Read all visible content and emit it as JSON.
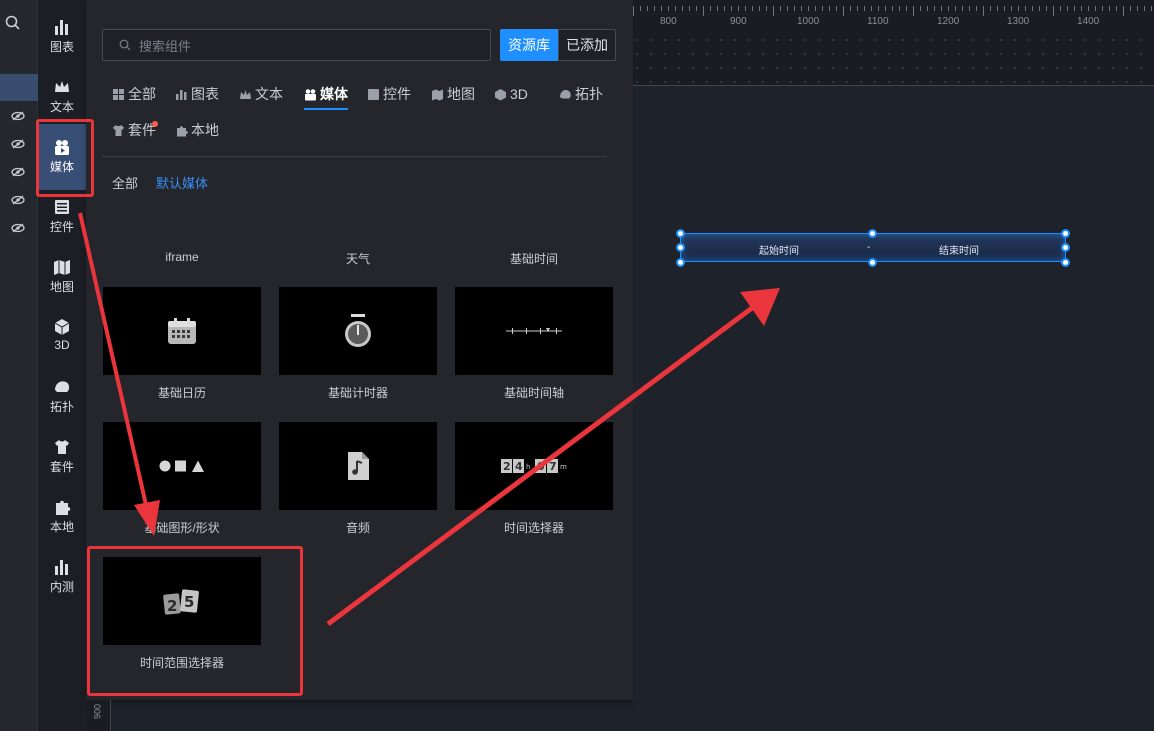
{
  "sidebar": {
    "categories": [
      {
        "label": "图表",
        "icon": "bar-chart-icon"
      },
      {
        "label": "文本",
        "icon": "crown-icon"
      },
      {
        "label": "媒体",
        "icon": "media-icon"
      },
      {
        "label": "控件",
        "icon": "widget-icon"
      },
      {
        "label": "地图",
        "icon": "map-icon"
      },
      {
        "label": "3D",
        "icon": "cube-icon"
      },
      {
        "label": "拓扑",
        "icon": "topology-icon"
      },
      {
        "label": "套件",
        "icon": "shirt-icon"
      },
      {
        "label": "本地",
        "icon": "puzzle-icon"
      },
      {
        "label": "内测",
        "icon": "bar-chart-icon"
      }
    ],
    "active_index": 2
  },
  "panel": {
    "search_placeholder": "搜索组件",
    "btn_library": "资源库",
    "btn_added": "已添加",
    "tabs": [
      "全部",
      "图表",
      "文本",
      "媒体",
      "控件",
      "地图",
      "3D",
      "拓扑",
      "套件",
      "本地"
    ],
    "active_tab": "媒体",
    "subtabs": [
      "全部",
      "默认媒体"
    ],
    "active_subtab": "默认媒体",
    "top_labels": [
      "iframe",
      "天气",
      "基础时间"
    ],
    "components": [
      {
        "label": "基础日历",
        "icon": "calendar-icon"
      },
      {
        "label": "基础计时器",
        "icon": "stopwatch-icon"
      },
      {
        "label": "基础时间轴",
        "icon": "timeline-icon"
      },
      {
        "label": "基础图形/形状",
        "icon": "shapes-icon"
      },
      {
        "label": "音频",
        "icon": "audio-file-icon"
      },
      {
        "label": "时间选择器",
        "icon": "flip-clock-icon"
      },
      {
        "label": "时间范围选择器",
        "icon": "date-range-icon"
      }
    ]
  },
  "ruler": {
    "ticks": [
      "800",
      "900",
      "1000",
      "1100",
      "1200",
      "1300",
      "1400"
    ],
    "side_label": "006"
  },
  "canvas_widget": {
    "start_label": "起始时间",
    "separator": "-",
    "end_label": "结束时间"
  },
  "colors": {
    "accent": "#1f8fff",
    "highlight": "#e9353b",
    "active_category": "#384e74"
  }
}
